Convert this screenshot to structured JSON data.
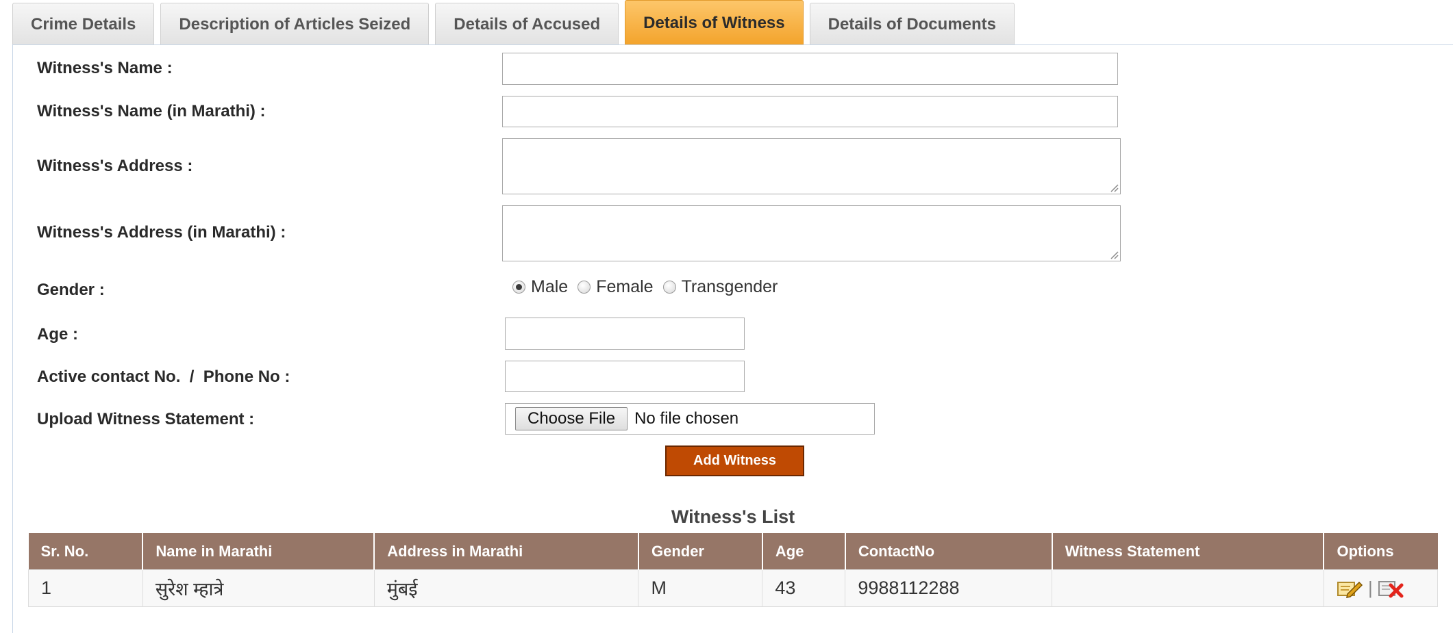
{
  "tabs": [
    {
      "label": "Crime Details"
    },
    {
      "label": "Description of Articles Seized"
    },
    {
      "label": "Details of Accused"
    },
    {
      "label": "Details of Witness",
      "active": true
    },
    {
      "label": "Details of Documents"
    }
  ],
  "form": {
    "name_label": "Witness's Name :",
    "name_value": "",
    "name_marathi_label": "Witness's Name (in Marathi) :",
    "name_marathi_value": "",
    "address_label": "Witness's Address :",
    "address_value": "",
    "address_marathi_label": "Witness's Address (in Marathi) :",
    "address_marathi_value": "",
    "gender_label": "Gender :",
    "gender_options": [
      "Male",
      "Female",
      "Transgender"
    ],
    "gender_selected": "Male",
    "age_label": "Age :",
    "age_value": "",
    "contact_label": "Active contact No.  /  Phone No :",
    "contact_value": "",
    "upload_label": "Upload Witness Statement :",
    "choose_file_label": "Choose File",
    "no_file_text": "No file chosen",
    "add_button_label": "Add Witness"
  },
  "witness_list": {
    "title": "Witness's List",
    "columns": [
      "Sr. No.",
      "Name in Marathi",
      "Address in Marathi",
      "Gender",
      "Age",
      "ContactNo",
      "Witness Statement",
      "Options"
    ],
    "rows": [
      {
        "sr": "1",
        "name": "सुरेश म्हात्रे",
        "address": "मुंबई",
        "gender": "M",
        "age": "43",
        "contact": "9988112288",
        "statement": ""
      }
    ],
    "option_icons": [
      "edit-icon",
      "delete-icon"
    ],
    "option_separator": "|"
  },
  "colors": {
    "active_tab": "#f3a32b",
    "table_header": "#967667",
    "add_button": "#bf4a03"
  }
}
